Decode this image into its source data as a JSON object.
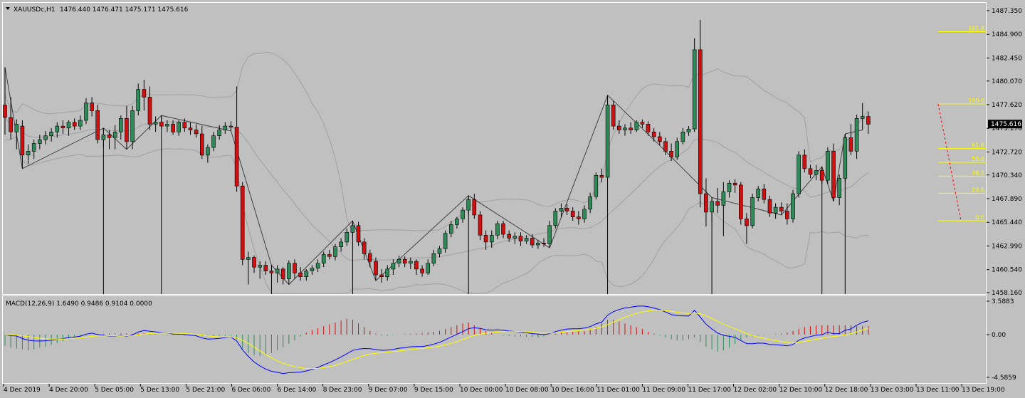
{
  "header": {
    "symbol": "XAUUSDc,H1",
    "ohlc": "1476.440 1476.471 1475.171 1475.616"
  },
  "macd_header": "MACD(12,26,9) 1.6490 0.9486 0.9104 0.0000",
  "price_axis": {
    "ticks": [
      "1487.350",
      "1484.900",
      "1482.450",
      "1480.070",
      "1477.620",
      "1475.170",
      "1472.720",
      "1470.340",
      "1467.890",
      "1465.440",
      "1462.990",
      "1460.540",
      "1458.160"
    ],
    "current": "1475.616"
  },
  "macd_axis": {
    "ticks": [
      "3.5883",
      "0.00",
      "-4.5859"
    ]
  },
  "time_axis": {
    "labels": [
      "4 Dec 2019",
      "4 Dec 20:00",
      "5 Dec 05:00",
      "5 Dec 13:00",
      "5 Dec 21:00",
      "6 Dec 06:00",
      "6 Dec 14:00",
      "8 Dec 23:00",
      "9 Dec 07:00",
      "9 Dec 15:00",
      "10 Dec 00:00",
      "10 Dec 08:00",
      "10 Dec 16:00",
      "11 Dec 01:00",
      "11 Dec 09:00",
      "11 Dec 17:00",
      "12 Dec 02:00",
      "12 Dec 10:00",
      "12 Dec 18:00",
      "13 Dec 03:00",
      "13 Dec 11:00",
      "13 Dec 19:00"
    ]
  },
  "fib_levels": [
    "161.8",
    "100.0",
    "61.8",
    "50.0",
    "38.2",
    "23.6",
    "0.0"
  ],
  "colors": {
    "bg": "#c0c0c0",
    "bull": "#2e8b57",
    "bear": "#d01010",
    "zigzag": "#404040",
    "bands": "#a0a0a0",
    "macd_line": "#0000ff",
    "signal_line": "#ffff00",
    "fib": "#ffff00"
  },
  "chart_data": {
    "type": "candlestick",
    "title": "XAUUSDc,H1",
    "ylim": [
      1458.16,
      1487.35
    ],
    "candles": [
      [
        1477.6,
        1481.5,
        1474.5,
        1476.3
      ],
      [
        1476.3,
        1478.4,
        1474.0,
        1474.8
      ],
      [
        1474.8,
        1476.1,
        1473.0,
        1475.6
      ],
      [
        1475.4,
        1476.0,
        1471.0,
        1472.4
      ],
      [
        1472.4,
        1473.5,
        1471.5,
        1472.8
      ],
      [
        1472.8,
        1474.0,
        1472.0,
        1473.6
      ],
      [
        1473.6,
        1474.5,
        1473.0,
        1474.0
      ],
      [
        1474.0,
        1474.9,
        1473.5,
        1474.4
      ],
      [
        1474.4,
        1475.2,
        1473.8,
        1474.8
      ],
      [
        1474.8,
        1475.8,
        1474.2,
        1475.4
      ],
      [
        1475.4,
        1476.0,
        1474.6,
        1475.2
      ],
      [
        1475.2,
        1476.0,
        1474.4,
        1475.8
      ],
      [
        1475.8,
        1476.2,
        1475.0,
        1475.4
      ],
      [
        1475.4,
        1476.5,
        1475.0,
        1476.0
      ],
      [
        1476.0,
        1478.3,
        1475.6,
        1477.8
      ],
      [
        1477.8,
        1478.4,
        1476.4,
        1477.0
      ],
      [
        1477.0,
        1477.6,
        1473.6,
        1474.0
      ],
      [
        1474.0,
        1475.2,
        1473.2,
        1474.5
      ],
      [
        1474.5,
        1475.0,
        1473.0,
        1474.2
      ],
      [
        1474.2,
        1475.5,
        1473.0,
        1474.8
      ],
      [
        1474.8,
        1476.5,
        1474.0,
        1476.2
      ],
      [
        1476.2,
        1477.5,
        1473.0,
        1473.8
      ],
      [
        1473.8,
        1477.5,
        1473.0,
        1477.0
      ],
      [
        1477.0,
        1479.8,
        1476.5,
        1479.2
      ],
      [
        1479.2,
        1480.2,
        1477.0,
        1478.4
      ],
      [
        1478.4,
        1479.5,
        1475.0,
        1475.6
      ],
      [
        1475.6,
        1476.4,
        1474.8,
        1475.8
      ],
      [
        1475.8,
        1476.5,
        1475.2,
        1475.4
      ],
      [
        1475.4,
        1476.0,
        1474.8,
        1475.6
      ],
      [
        1475.6,
        1476.0,
        1474.5,
        1474.8
      ],
      [
        1474.8,
        1476.0,
        1474.4,
        1475.8
      ],
      [
        1475.8,
        1476.2,
        1474.8,
        1475.2
      ],
      [
        1475.2,
        1475.8,
        1474.5,
        1475.0
      ],
      [
        1475.0,
        1475.6,
        1474.2,
        1474.6
      ],
      [
        1474.6,
        1475.4,
        1472.0,
        1472.4
      ],
      [
        1472.4,
        1473.5,
        1471.6,
        1473.2
      ],
      [
        1473.2,
        1474.8,
        1472.8,
        1474.4
      ],
      [
        1474.4,
        1475.5,
        1474.0,
        1475.0
      ],
      [
        1475.0,
        1475.8,
        1474.6,
        1475.4
      ],
      [
        1475.4,
        1475.9,
        1474.9,
        1475.3
      ],
      [
        1475.3,
        1479.5,
        1468.6,
        1469.2
      ],
      [
        1469.2,
        1469.6,
        1461.0,
        1461.6
      ],
      [
        1461.6,
        1462.4,
        1459.0,
        1461.8
      ],
      [
        1461.8,
        1462.0,
        1460.2,
        1460.8
      ],
      [
        1460.8,
        1461.4,
        1459.6,
        1461.0
      ],
      [
        1461.0,
        1461.4,
        1460.0,
        1460.4
      ],
      [
        1460.4,
        1461.0,
        1459.8,
        1460.2
      ],
      [
        1460.2,
        1461.0,
        1459.2,
        1460.6
      ],
      [
        1460.6,
        1460.8,
        1459.0,
        1459.6
      ],
      [
        1459.6,
        1461.5,
        1459.0,
        1461.2
      ],
      [
        1461.2,
        1461.6,
        1459.6,
        1460.2
      ],
      [
        1460.2,
        1460.8,
        1459.4,
        1459.8
      ],
      [
        1459.8,
        1460.6,
        1459.4,
        1460.4
      ],
      [
        1460.4,
        1461.0,
        1460.0,
        1460.7
      ],
      [
        1460.7,
        1461.6,
        1460.3,
        1461.2
      ],
      [
        1461.2,
        1462.4,
        1460.8,
        1462.1
      ],
      [
        1462.1,
        1462.6,
        1461.6,
        1461.9
      ],
      [
        1461.9,
        1463.2,
        1461.5,
        1462.9
      ],
      [
        1462.9,
        1463.8,
        1462.4,
        1463.4
      ],
      [
        1463.4,
        1464.8,
        1463.0,
        1464.4
      ],
      [
        1464.4,
        1465.6,
        1464.0,
        1465.1
      ],
      [
        1465.1,
        1465.5,
        1463.0,
        1463.4
      ],
      [
        1463.4,
        1463.8,
        1461.6,
        1462.2
      ],
      [
        1462.2,
        1462.6,
        1460.8,
        1461.4
      ],
      [
        1461.4,
        1461.8,
        1459.4,
        1460.0
      ],
      [
        1460.0,
        1460.6,
        1459.2,
        1459.8
      ],
      [
        1459.8,
        1461.0,
        1459.4,
        1460.6
      ],
      [
        1460.6,
        1461.6,
        1460.0,
        1461.2
      ],
      [
        1461.2,
        1462.0,
        1460.8,
        1461.6
      ],
      [
        1461.6,
        1461.9,
        1460.8,
        1461.2
      ],
      [
        1461.2,
        1461.8,
        1460.6,
        1461.4
      ],
      [
        1461.4,
        1461.6,
        1460.0,
        1460.6
      ],
      [
        1460.6,
        1461.0,
        1459.8,
        1460.2
      ],
      [
        1460.2,
        1461.6,
        1460.0,
        1461.2
      ],
      [
        1461.2,
        1462.6,
        1460.9,
        1462.2
      ],
      [
        1462.2,
        1463.0,
        1461.8,
        1462.7
      ],
      [
        1462.7,
        1464.6,
        1462.3,
        1464.3
      ],
      [
        1464.3,
        1465.6,
        1463.9,
        1465.2
      ],
      [
        1465.2,
        1466.0,
        1464.8,
        1465.8
      ],
      [
        1465.8,
        1467.0,
        1465.4,
        1466.7
      ],
      [
        1466.7,
        1468.2,
        1466.3,
        1467.8
      ],
      [
        1467.8,
        1468.4,
        1465.8,
        1466.2
      ],
      [
        1466.2,
        1466.6,
        1463.6,
        1464.1
      ],
      [
        1464.1,
        1464.6,
        1462.6,
        1463.4
      ],
      [
        1463.4,
        1464.6,
        1462.8,
        1464.1
      ],
      [
        1464.1,
        1465.6,
        1463.7,
        1465.3
      ],
      [
        1465.3,
        1465.6,
        1463.8,
        1464.2
      ],
      [
        1464.2,
        1464.6,
        1463.4,
        1463.8
      ],
      [
        1463.8,
        1464.4,
        1463.2,
        1464.0
      ],
      [
        1464.0,
        1464.4,
        1463.0,
        1463.5
      ],
      [
        1463.5,
        1464.1,
        1463.2,
        1463.8
      ],
      [
        1463.8,
        1464.2,
        1462.8,
        1463.1
      ],
      [
        1463.1,
        1463.6,
        1462.7,
        1463.3
      ],
      [
        1463.3,
        1463.8,
        1462.9,
        1463.2
      ],
      [
        1463.2,
        1465.6,
        1462.8,
        1465.1
      ],
      [
        1465.1,
        1466.9,
        1464.8,
        1466.6
      ],
      [
        1466.6,
        1467.4,
        1466.0,
        1466.9
      ],
      [
        1466.9,
        1467.3,
        1466.2,
        1466.6
      ],
      [
        1466.6,
        1467.0,
        1465.6,
        1466.0
      ],
      [
        1466.0,
        1466.6,
        1465.2,
        1465.8
      ],
      [
        1465.8,
        1467.2,
        1465.4,
        1466.8
      ],
      [
        1466.8,
        1468.5,
        1466.4,
        1468.1
      ],
      [
        1468.1,
        1470.6,
        1467.8,
        1470.3
      ],
      [
        1470.3,
        1471.0,
        1469.6,
        1470.1
      ],
      [
        1470.1,
        1478.6,
        1469.8,
        1477.6
      ],
      [
        1477.6,
        1478.0,
        1475.0,
        1475.4
      ],
      [
        1475.4,
        1476.0,
        1474.6,
        1475.0
      ],
      [
        1475.0,
        1475.6,
        1474.4,
        1475.2
      ],
      [
        1475.2,
        1475.8,
        1474.6,
        1475.0
      ],
      [
        1475.0,
        1476.0,
        1474.8,
        1475.8
      ],
      [
        1475.8,
        1476.1,
        1475.2,
        1475.6
      ],
      [
        1475.6,
        1475.9,
        1474.4,
        1474.8
      ],
      [
        1474.8,
        1475.2,
        1473.8,
        1474.3
      ],
      [
        1474.3,
        1474.8,
        1473.4,
        1473.8
      ],
      [
        1473.8,
        1474.2,
        1472.4,
        1472.8
      ],
      [
        1472.8,
        1473.6,
        1471.8,
        1472.2
      ],
      [
        1472.2,
        1474.2,
        1471.9,
        1473.8
      ],
      [
        1473.8,
        1475.2,
        1473.5,
        1474.8
      ],
      [
        1474.8,
        1475.4,
        1474.4,
        1475.1
      ],
      [
        1475.1,
        1484.5,
        1474.8,
        1483.3
      ],
      [
        1483.3,
        1486.4,
        1467.0,
        1468.4
      ],
      [
        1468.4,
        1470.0,
        1465.0,
        1466.5
      ],
      [
        1466.5,
        1468.0,
        1465.4,
        1467.6
      ],
      [
        1467.6,
        1469.0,
        1466.4,
        1467.2
      ],
      [
        1467.2,
        1469.6,
        1464.0,
        1468.6
      ],
      [
        1468.6,
        1469.8,
        1468.0,
        1469.5
      ],
      [
        1469.5,
        1469.9,
        1468.5,
        1469.3
      ],
      [
        1469.3,
        1469.6,
        1465.2,
        1465.8
      ],
      [
        1465.8,
        1466.4,
        1463.2,
        1465.1
      ],
      [
        1465.1,
        1468.4,
        1464.8,
        1468.0
      ],
      [
        1468.0,
        1469.2,
        1467.6,
        1468.9
      ],
      [
        1468.9,
        1469.4,
        1467.4,
        1467.8
      ],
      [
        1467.8,
        1468.2,
        1466.0,
        1466.4
      ],
      [
        1466.4,
        1467.4,
        1465.8,
        1467.0
      ],
      [
        1467.0,
        1467.5,
        1466.2,
        1466.6
      ],
      [
        1466.6,
        1467.4,
        1465.2,
        1465.8
      ],
      [
        1465.8,
        1468.8,
        1465.4,
        1468.4
      ],
      [
        1468.4,
        1472.8,
        1468.0,
        1472.4
      ],
      [
        1472.4,
        1473.0,
        1470.6,
        1471.0
      ],
      [
        1471.0,
        1471.4,
        1470.0,
        1470.4
      ],
      [
        1470.4,
        1471.4,
        1469.8,
        1470.8
      ],
      [
        1470.8,
        1471.2,
        1469.4,
        1469.8
      ],
      [
        1469.8,
        1473.2,
        1469.4,
        1472.8
      ],
      [
        1472.8,
        1473.6,
        1467.6,
        1468.0
      ],
      [
        1468.0,
        1470.4,
        1467.2,
        1470.0
      ],
      [
        1470.0,
        1474.6,
        1469.6,
        1474.2
      ],
      [
        1474.2,
        1475.6,
        1472.4,
        1472.8
      ],
      [
        1472.8,
        1476.6,
        1472.0,
        1476.2
      ],
      [
        1476.2,
        1477.8,
        1475.0,
        1476.4
      ],
      [
        1476.4,
        1476.9,
        1474.6,
        1475.6
      ]
    ],
    "macd_hist": [
      -1.2,
      -1.4,
      -1.5,
      -1.6,
      -1.7,
      -1.6,
      -1.4,
      -1.3,
      -1.1,
      -0.9,
      -0.7,
      -0.5,
      -0.3,
      -0.2,
      -0.1,
      0.0,
      0.05,
      0.08,
      0.1,
      0.1,
      0.12,
      0.12,
      0.1,
      0.12,
      0.15,
      0.1,
      0.05,
      0.0,
      -0.05,
      -0.05,
      -0.05,
      -0.1,
      -0.1,
      -0.1,
      -0.15,
      -0.15,
      -0.15,
      -0.12,
      -0.12,
      -0.1,
      -0.5,
      -1.5,
      -2.0,
      -2.2,
      -2.3,
      -2.2,
      -2.0,
      -1.7,
      -1.4,
      -1.0,
      -0.6,
      -0.2,
      0.2,
      0.5,
      0.7,
      0.9,
      1.1,
      1.3,
      1.5,
      1.7,
      1.6,
      1.2,
      0.8,
      0.4,
      0.1,
      -0.1,
      -0.1,
      -0.05,
      0.0,
      0.05,
      0.08,
      0.1,
      0.15,
      0.2,
      0.3,
      0.4,
      0.6,
      0.8,
      1.0,
      1.2,
      1.3,
      1.0,
      0.7,
      0.4,
      0.2,
      0.0,
      -0.1,
      -0.15,
      -0.2,
      -0.2,
      -0.25,
      -0.25,
      -0.3,
      -0.2,
      0.0,
      0.1,
      0.2,
      0.25,
      0.3,
      0.35,
      0.4,
      0.6,
      0.8,
      1.2,
      1.6,
      1.6,
      1.4,
      1.2,
      1.0,
      0.8,
      0.6,
      0.3,
      0.1,
      -0.1,
      -0.3,
      -0.5,
      -0.6,
      -0.6,
      -0.5,
      -0.3,
      -0.8,
      -1.3,
      -1.6,
      -1.8,
      -1.7,
      -1.4,
      -1.0,
      -0.6,
      -0.3,
      -0.2,
      -0.1,
      -0.05,
      0.0,
      0.05,
      0.1,
      0.2,
      0.4,
      0.6,
      0.8,
      0.9,
      1.0,
      1.0,
      1.0,
      1.0,
      1.0,
      1.0,
      1.0,
      0.9,
      0.9,
      0.9
    ],
    "macd_ylim": [
      -4.5859,
      3.5883
    ]
  }
}
